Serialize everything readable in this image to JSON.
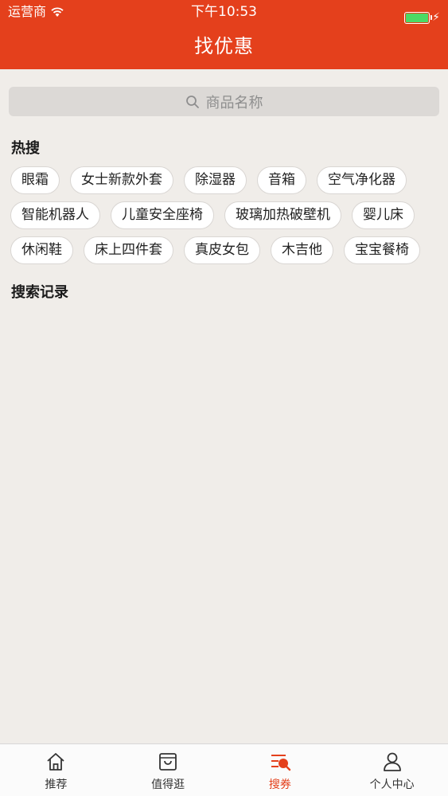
{
  "status_bar": {
    "carrier": "运营商",
    "time": "下午10:53",
    "icons": [
      "wifi-icon",
      "battery-icon",
      "charging-bolt-icon"
    ]
  },
  "header": {
    "title": "找优惠"
  },
  "search": {
    "placeholder": "商品名称",
    "icon": "search-icon"
  },
  "hot_search": {
    "title": "热搜",
    "rows": [
      [
        "眼霜",
        "女士新款外套",
        "除湿器",
        "音箱",
        "空气净化器"
      ],
      [
        "智能机器人",
        "儿童安全座椅",
        "玻璃加热破壁机",
        "婴儿床"
      ],
      [
        "休闲鞋",
        "床上四件套",
        "真皮女包",
        "木吉他",
        "宝宝餐椅"
      ]
    ]
  },
  "history": {
    "title": "搜索记录"
  },
  "tabbar": {
    "items": [
      {
        "label": "推荐",
        "icon": "home-icon"
      },
      {
        "label": "值得逛",
        "icon": "shopping-bag-icon"
      },
      {
        "label": "搜券",
        "icon": "coupon-search-icon",
        "active": true
      },
      {
        "label": "个人中心",
        "icon": "user-icon"
      }
    ]
  },
  "colors": {
    "brand": "#e4401c",
    "background": "#f0ede9",
    "battery": "#4cd964"
  }
}
